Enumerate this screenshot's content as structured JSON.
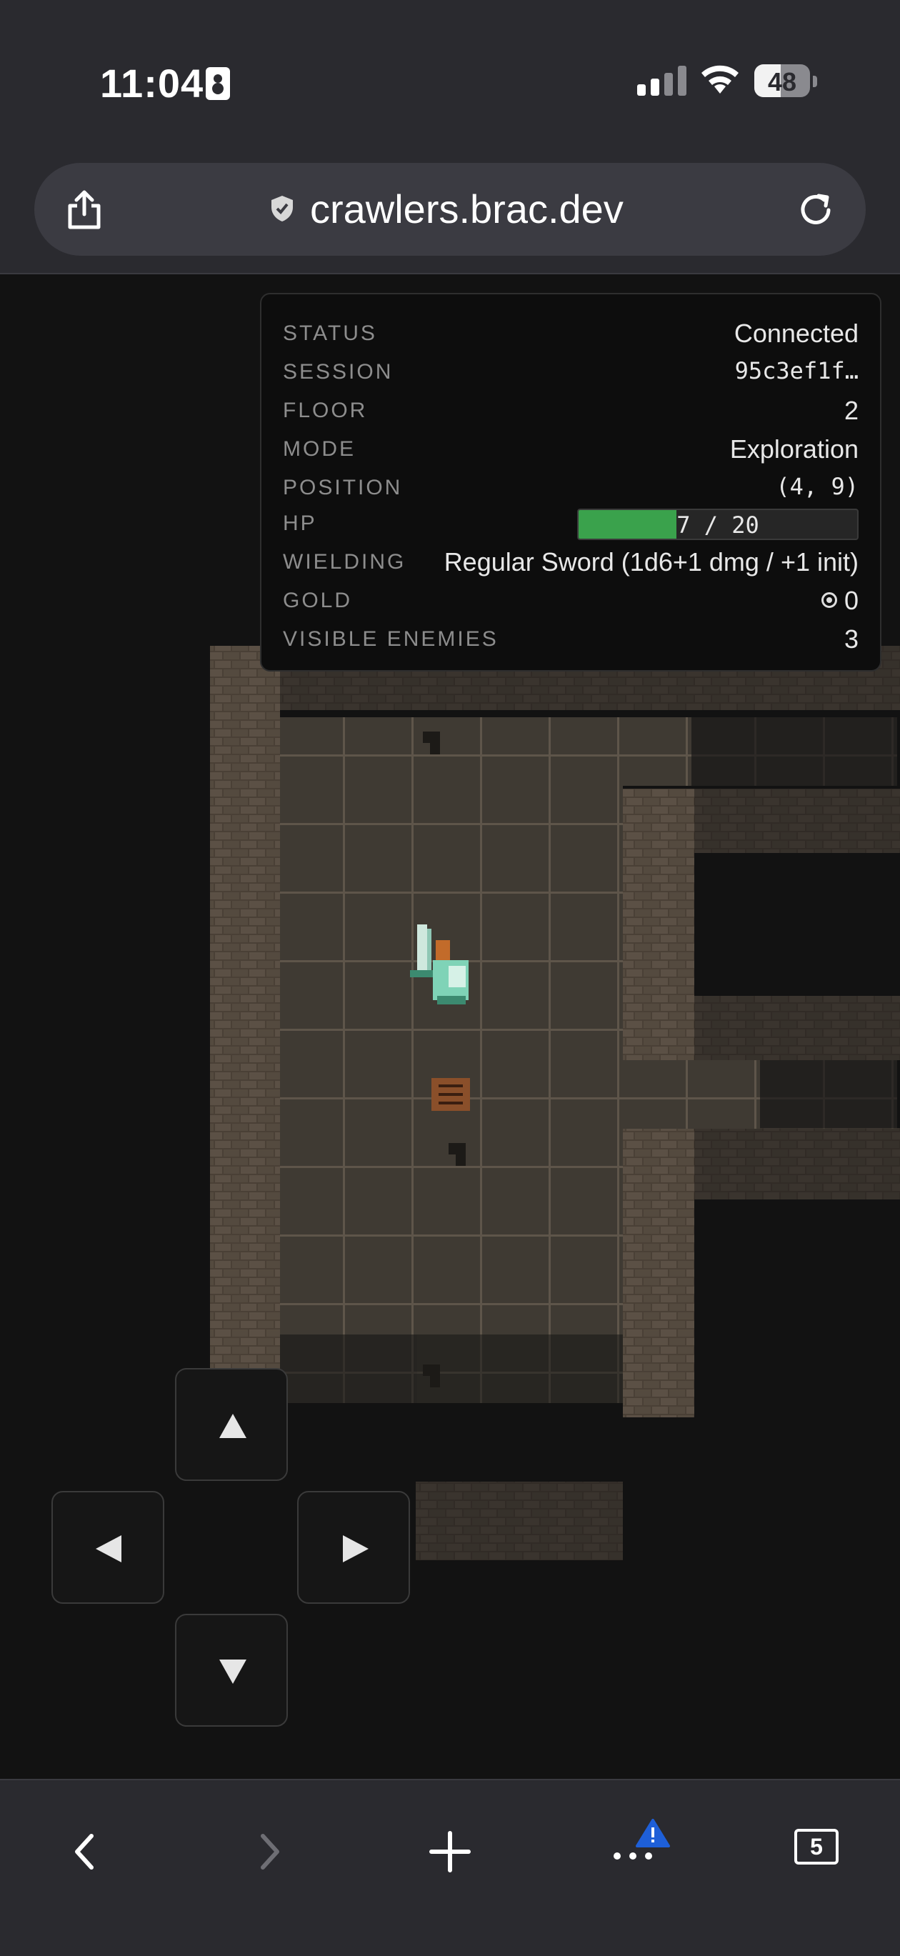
{
  "status_bar": {
    "time": "11:04",
    "battery": "48",
    "battery_level": 0.48
  },
  "browser": {
    "url": "crawlers.brac.dev",
    "tab_count": "5"
  },
  "panel": {
    "rows": [
      {
        "label": "STATUS",
        "value": "Connected"
      },
      {
        "label": "SESSION",
        "value": "95c3ef1f…"
      },
      {
        "label": "FLOOR",
        "value": "2"
      },
      {
        "label": "MODE",
        "value": "Exploration"
      },
      {
        "label": "POSITION",
        "value": "(4, 9)"
      },
      {
        "label": "HP",
        "value": "7 / 20"
      },
      {
        "label": "WIELDING",
        "value": "Regular Sword (1d6+1 dmg / +1 init)"
      },
      {
        "label": "GOLD",
        "value": "0"
      },
      {
        "label": "VISIBLE ENEMIES",
        "value": "3"
      }
    ],
    "hp_current": 7,
    "hp_max": 20
  },
  "colors": {
    "hp_fill": "#3aa24c",
    "floor": "#3f3a33",
    "wall": "#3c342c",
    "background": "#121212"
  }
}
